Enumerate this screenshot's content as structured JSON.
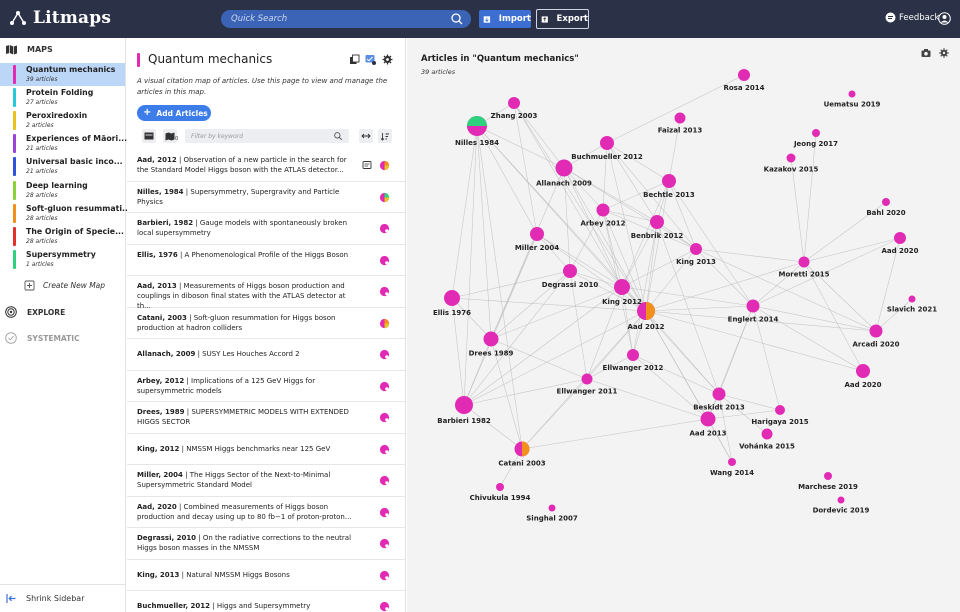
{
  "header": {
    "app_name": "Litmaps",
    "search_placeholder": "Quick Search",
    "import_label": "Import",
    "export_label": "Export",
    "feedback_label": "Feedback",
    "colors": {
      "bar": "#2b3146",
      "search": "#3b64b6",
      "import": "#3d6fd3"
    }
  },
  "sidebar": {
    "maps_heading": "MAPS",
    "maps": [
      {
        "name": "Quantum mechanics",
        "count": "39 articles",
        "color": "#e22bb5",
        "active": true
      },
      {
        "name": "Protein Folding",
        "count": "27 articles",
        "color": "#27c9d9"
      },
      {
        "name": "Peroxiredoxin",
        "count": "2 articles",
        "color": "#e8c21f"
      },
      {
        "name": "Experiences of Māori...",
        "count": "21 articles",
        "color": "#9a43d8"
      },
      {
        "name": "Universal basic inco...",
        "count": "21 articles",
        "color": "#2f52d8"
      },
      {
        "name": "Deep learning",
        "count": "28 articles",
        "color": "#8bd23a"
      },
      {
        "name": "Soft-gluon resummati...",
        "count": "28 articles",
        "color": "#f2901c"
      },
      {
        "name": "The Origin of Specie...",
        "count": "28 articles",
        "color": "#e0322b"
      },
      {
        "name": "Supersymmetry",
        "count": "1 articles",
        "color": "#2ed17d"
      }
    ],
    "create_label": "Create New Map",
    "explore_label": "EXPLORE",
    "systematic_label": "SYSTEMATIC",
    "shrink_label": "Shrink Sidebar"
  },
  "panel": {
    "title": "Quantum mechanics",
    "description": "A visual citation map of articles. Use this page to view and manage the articles in this map.",
    "add_label": "Add Articles",
    "filter_placeholder": "Filter by keyword",
    "filter_badge": "0",
    "articles": [
      {
        "ref": "Aad, 2012",
        "title": "Observation of a new particle in the search for the Standard Model Higgs boson with the ATLAS detector...",
        "dot": "mix-orange",
        "extra": true
      },
      {
        "ref": "Nilles, 1984",
        "title": "Supersymmetry, Supergravity and Particle Physics",
        "dot": "mix-green"
      },
      {
        "ref": "Barbieri, 1982",
        "title": "Gauge models with spontaneously broken local supersymmetry",
        "dot": "pink"
      },
      {
        "ref": "Ellis, 1976",
        "title": "A Phenomenological Profile of the Higgs Boson",
        "dot": "pink"
      },
      {
        "ref": "Aad, 2013",
        "title": "Measurements of Higgs boson production and couplings in diboson final states with the ATLAS detector at th...",
        "dot": "pink"
      },
      {
        "ref": "Catani, 2003",
        "title": "Soft-gluon resummation for Higgs boson production at hadron colliders",
        "dot": "mix-orange"
      },
      {
        "ref": "Allanach, 2009",
        "title": "SUSY Les Houches Accord 2",
        "dot": "pink"
      },
      {
        "ref": "Arbey, 2012",
        "title": "Implications of a 125 GeV Higgs for supersymmetric models",
        "dot": "pink"
      },
      {
        "ref": "Drees, 1989",
        "title": "SUPERSYMMETRIC MODELS WITH EXTENDED HIGGS SECTOR",
        "dot": "pink"
      },
      {
        "ref": "King, 2012",
        "title": "NMSSM Higgs benchmarks near 125 GeV",
        "dot": "pink"
      },
      {
        "ref": "Miller, 2004",
        "title": "The Higgs Sector of the Next-to-Minimal Supersymmetric Standard Model",
        "dot": "pink"
      },
      {
        "ref": "Aad, 2020",
        "title": "Combined measurements of Higgs boson production and decay using up to 80 fb−1 of proton-proton...",
        "dot": "pink"
      },
      {
        "ref": "Degrassi, 2010",
        "title": "On the radiative corrections to the neutral Higgs boson masses in the NMSSM",
        "dot": "pink"
      },
      {
        "ref": "King, 2013",
        "title": "Natural NMSSM Higgs Bosons",
        "dot": "pink"
      },
      {
        "ref": "Buchmueller, 2012",
        "title": "Higgs and Supersymmetry",
        "dot": "pink"
      }
    ]
  },
  "graph": {
    "title": "Articles in \"Quantum mechanics\"",
    "count": "39 articles",
    "colors": {
      "node": "#e22bb5",
      "alt_green": "#2ed17d",
      "alt_orange": "#f2901c",
      "edge": "#b9b9b9"
    },
    "nodes": [
      {
        "label": "Rosa 2014",
        "mix": null
      },
      {
        "label": "Uematsu 2019",
        "mix": null
      },
      {
        "label": "Zhang 2003",
        "mix": null
      },
      {
        "label": "Faizal 2013",
        "mix": null
      },
      {
        "label": "Nilles 1984",
        "mix": "green"
      },
      {
        "label": "Jeong 2017",
        "mix": null
      },
      {
        "label": "Buchmueller 2012",
        "mix": null
      },
      {
        "label": "Kazakov 2015",
        "mix": null
      },
      {
        "label": "Allanach 2009",
        "mix": null
      },
      {
        "label": "Bechtle 2013",
        "mix": null
      },
      {
        "label": "Bahl 2020",
        "mix": null
      },
      {
        "label": "Arbey 2012",
        "mix": null
      },
      {
        "label": "Benbrik 2012",
        "mix": null
      },
      {
        "label": "Aad 2020",
        "mix": null
      },
      {
        "label": "Miller 2004",
        "mix": null
      },
      {
        "label": "King 2013",
        "mix": null
      },
      {
        "label": "Moretti 2015",
        "mix": null
      },
      {
        "label": "Degrassi 2010",
        "mix": null
      },
      {
        "label": "King 2012",
        "mix": null
      },
      {
        "label": "Ellis 1976",
        "mix": null
      },
      {
        "label": "Aad 2012",
        "mix": "orange"
      },
      {
        "label": "Englert 2014",
        "mix": null
      },
      {
        "label": "Slavich 2021",
        "mix": null
      },
      {
        "label": "Arcadi 2020",
        "mix": null
      },
      {
        "label": "Drees 1989",
        "mix": null
      },
      {
        "label": "Ellwanger 2012",
        "mix": null
      },
      {
        "label": "Aad 2020",
        "mix": null
      },
      {
        "label": "Ellwanger 2011",
        "mix": null
      },
      {
        "label": "Beskidt 2013",
        "mix": null
      },
      {
        "label": "Barbieri 1982",
        "mix": null
      },
      {
        "label": "Harigaya 2015",
        "mix": null
      },
      {
        "label": "Aad 2013",
        "mix": null
      },
      {
        "label": "Vohánka 2015",
        "mix": null
      },
      {
        "label": "Catani 2003",
        "mix": "orange"
      },
      {
        "label": "Wang 2014",
        "mix": null
      },
      {
        "label": "Marchese 2019",
        "mix": null
      },
      {
        "label": "Chivukula 1994",
        "mix": null
      },
      {
        "label": "Dordevic 2019",
        "mix": null
      },
      {
        "label": "Singhal 2007",
        "mix": null
      }
    ]
  }
}
